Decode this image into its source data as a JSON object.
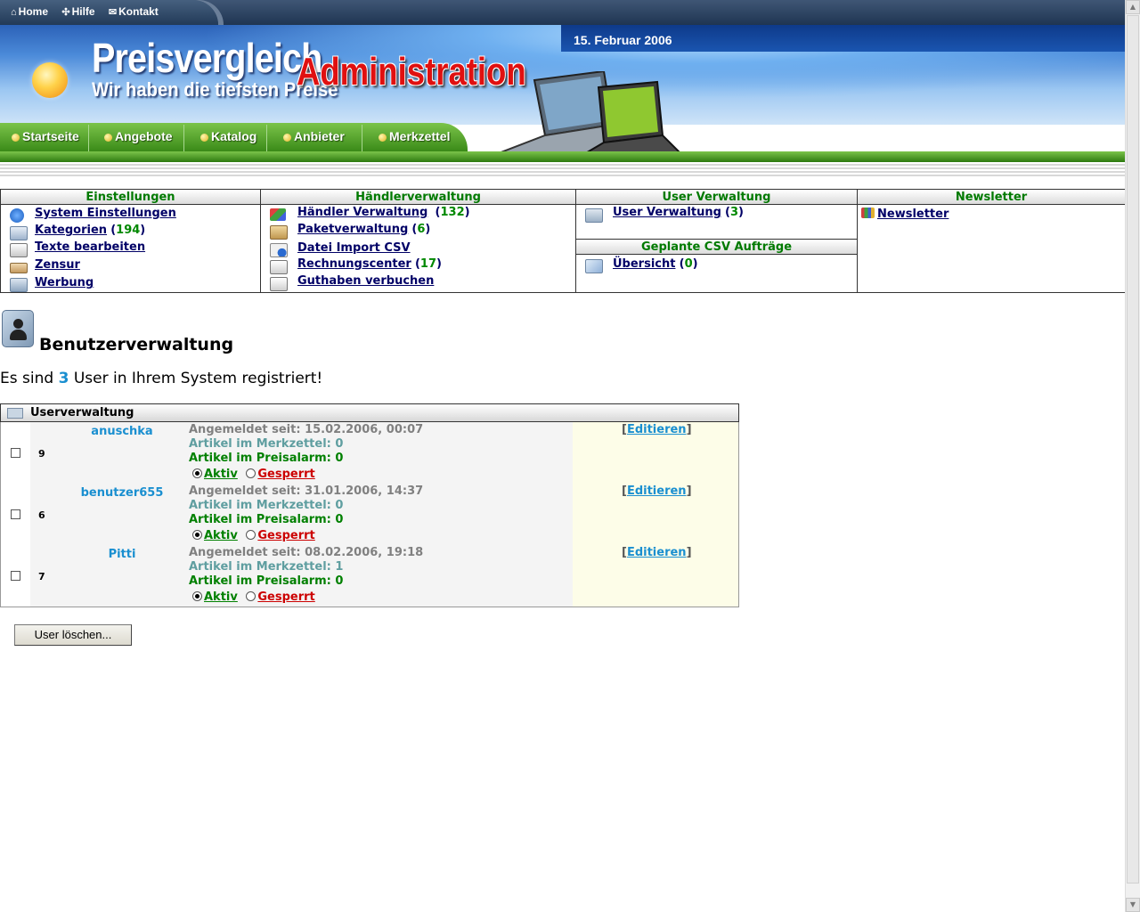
{
  "toplinks": [
    {
      "icon": "home-icon",
      "glyph": "⌂",
      "label": "Home"
    },
    {
      "icon": "help-icon",
      "glyph": "✣",
      "label": "Hilfe"
    },
    {
      "icon": "mail-icon",
      "glyph": "✉",
      "label": "Kontakt"
    }
  ],
  "header": {
    "date": "15. Februar 2006",
    "title": "Preisvergleich",
    "slogan": "Wir haben die tiefsten Preise",
    "overlay": "Administration"
  },
  "nav": [
    "Startseite",
    "Angebote",
    "Katalog",
    "Anbieter",
    "Merkzettel"
  ],
  "menu": {
    "einstellungen": {
      "title": "Einstellungen",
      "items": [
        {
          "label": "System Einstellungen",
          "count": ""
        },
        {
          "label": "Kategorien",
          "count": "194"
        },
        {
          "label": "Texte bearbeiten",
          "count": ""
        },
        {
          "label": "Zensur",
          "count": ""
        },
        {
          "label": "Werbung",
          "count": ""
        }
      ]
    },
    "haendler": {
      "title": "Händlerverwaltung",
      "items": [
        {
          "label": "Händler Verwaltung",
          "count": "132"
        },
        {
          "label": "Paketverwaltung",
          "count": "6"
        },
        {
          "label": "Datei Import CSV",
          "count": ""
        },
        {
          "label": "Rechnungscenter",
          "count": "17"
        },
        {
          "label": "Guthaben verbuchen",
          "count": ""
        }
      ]
    },
    "user": {
      "title": "User Verwaltung",
      "items": [
        {
          "label": "User Verwaltung",
          "count": "3"
        }
      ]
    },
    "csv": {
      "title": "Geplante CSV Aufträge",
      "items": [
        {
          "label": "Übersicht",
          "count": "0"
        }
      ]
    },
    "newsletter": {
      "title": "Newsletter",
      "items": [
        {
          "label": "Newsletter",
          "count": ""
        }
      ]
    }
  },
  "page": {
    "heading": "Benutzerverwaltung",
    "info_pre": "Es sind",
    "info_count": "3",
    "info_post": "User in Ihrem System registriert!",
    "table_title": "Userverwaltung",
    "delete_button": "User löschen..."
  },
  "users": [
    {
      "id": "9",
      "name": "anuschka",
      "since": "Angemeldet seit: 15.02.2006, 00:07",
      "merkzettel": "Artikel im Merkzettel: 0",
      "preisalarm": "Artikel im Preisalarm: 0",
      "status": "aktiv"
    },
    {
      "id": "6",
      "name": "benutzer655",
      "since": "Angemeldet seit: 31.01.2006, 14:37",
      "merkzettel": "Artikel im Merkzettel: 0",
      "preisalarm": "Artikel im Preisalarm: 0",
      "status": "aktiv"
    },
    {
      "id": "7",
      "name": "Pitti",
      "since": "Angemeldet seit: 08.02.2006, 19:18",
      "merkzettel": "Artikel im Merkzettel: 1",
      "preisalarm": "Artikel im Preisalarm: 0",
      "status": "aktiv"
    }
  ],
  "labels": {
    "aktiv": "Aktiv",
    "gesperrt": "Gesperrt",
    "edit": "Editieren"
  },
  "colors": {
    "accent_green": "#008000",
    "link_blue": "#1a8fd0",
    "nav_green": "#3a8a18",
    "banner_blue": "#2c62b8",
    "alert_red": "#cc0000"
  }
}
